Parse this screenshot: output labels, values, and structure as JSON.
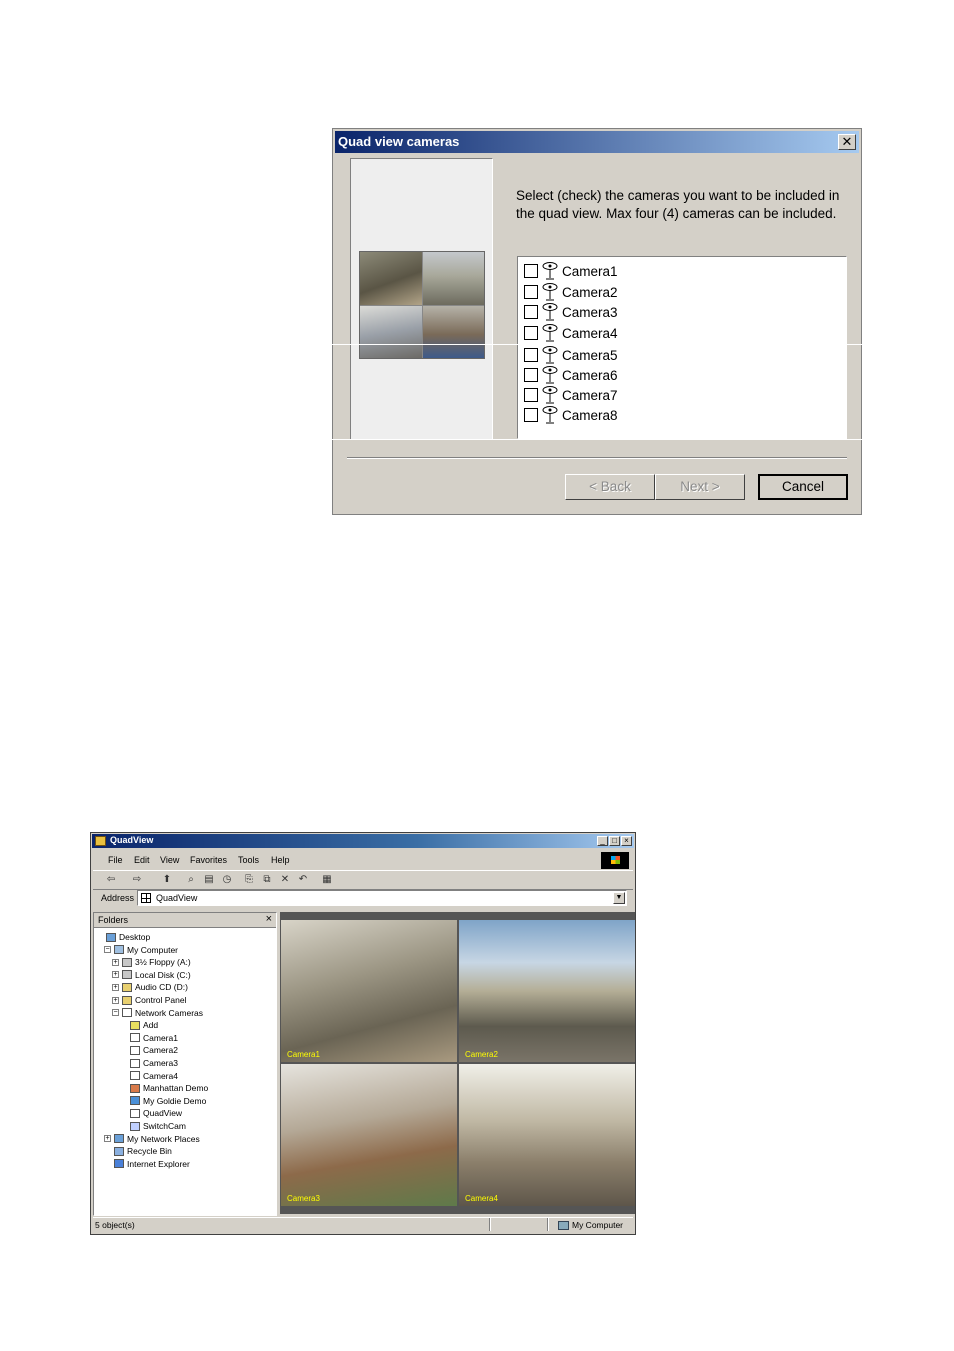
{
  "dialog": {
    "title": "Quad view cameras",
    "close_glyph": "✕",
    "instruction": "Select (check) the cameras you want to be included in the quad view. Max four (4) cameras can be included.",
    "cameras": [
      "Camera1",
      "Camera2",
      "Camera3",
      "Camera4",
      "Camera5",
      "Camera6",
      "Camera7",
      "Camera8"
    ],
    "buttons": {
      "back": "< Back",
      "next": "Next >",
      "cancel": "Cancel"
    }
  },
  "explorer": {
    "title": "QuadView",
    "menu": [
      "File",
      "Edit",
      "View",
      "Favorites",
      "Tools",
      "Help"
    ],
    "address_label": "Address",
    "address_value": "QuadView",
    "folders_header": "Folders",
    "tree": [
      {
        "label": "Desktop",
        "toggle": ""
      },
      {
        "label": "My Computer",
        "toggle": "−"
      },
      {
        "label": "3½ Floppy (A:)",
        "toggle": "+"
      },
      {
        "label": "Local Disk (C:)",
        "toggle": "+"
      },
      {
        "label": "Audio CD (D:)",
        "toggle": "+"
      },
      {
        "label": "Control Panel",
        "toggle": "+"
      },
      {
        "label": "Network Cameras",
        "toggle": "−"
      },
      {
        "label": "Add",
        "toggle": ""
      },
      {
        "label": "Camera1",
        "toggle": ""
      },
      {
        "label": "Camera2",
        "toggle": ""
      },
      {
        "label": "Camera3",
        "toggle": ""
      },
      {
        "label": "Camera4",
        "toggle": ""
      },
      {
        "label": "Manhattan Demo",
        "toggle": ""
      },
      {
        "label": "My Goldie Demo",
        "toggle": ""
      },
      {
        "label": "QuadView",
        "toggle": ""
      },
      {
        "label": "SwitchCam",
        "toggle": ""
      },
      {
        "label": "My Network Places",
        "toggle": "+"
      },
      {
        "label": "Recycle Bin",
        "toggle": ""
      },
      {
        "label": "Internet Explorer",
        "toggle": ""
      }
    ],
    "views": [
      "Camera1",
      "Camera2",
      "Camera3",
      "Camera4"
    ],
    "status_left": "5 object(s)",
    "status_right": "My Computer"
  }
}
